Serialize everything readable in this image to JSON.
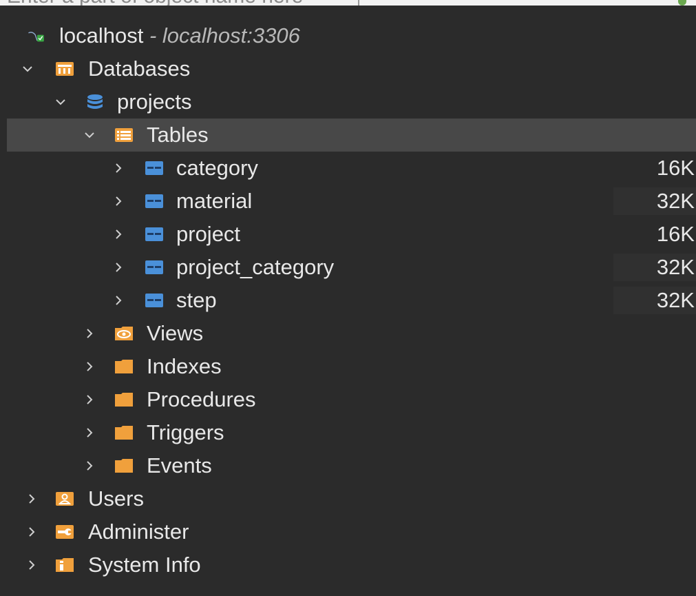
{
  "search": {
    "placeholder": "Enter a part of object name here"
  },
  "connection": {
    "name": "localhost",
    "detail": "- localhost:3306"
  },
  "tree": {
    "databases_label": "Databases",
    "schema_label": "projects",
    "tables_label": "Tables",
    "tables": [
      {
        "name": "category",
        "size": "16K"
      },
      {
        "name": "material",
        "size": "32K"
      },
      {
        "name": "project",
        "size": "16K"
      },
      {
        "name": "project_category",
        "size": "32K"
      },
      {
        "name": "step",
        "size": "32K"
      }
    ],
    "views_label": "Views",
    "indexes_label": "Indexes",
    "procedures_label": "Procedures",
    "triggers_label": "Triggers",
    "events_label": "Events",
    "users_label": "Users",
    "administer_label": "Administer",
    "system_info_label": "System Info"
  },
  "colors": {
    "background": "#2b2b2b",
    "selected_row": "#484848",
    "folder_orange": "#f0a03c",
    "table_blue": "#4a90d9"
  }
}
